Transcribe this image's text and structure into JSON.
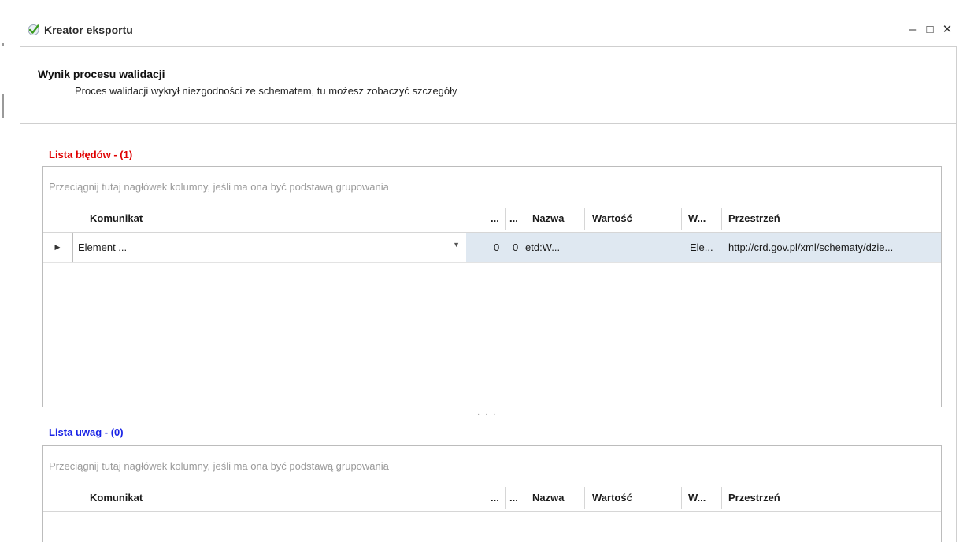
{
  "window": {
    "title": "Kreator eksportu",
    "buttons": {
      "minimize": "‒",
      "maximize": "□",
      "close": "✕"
    }
  },
  "header": {
    "title": "Wynik procesu walidacji",
    "subtitle": "Proces walidacji wykrył niezgodności ze schematem, tu możesz zobaczyć szczegóły"
  },
  "errors": {
    "label": "Lista błędów - (1)",
    "label_color": "#e00000",
    "group_panel": "Przeciągnij tutaj nagłówek kolumny, jeśli ma ona być podstawą grupowania",
    "columns": [
      "Komunikat",
      "...",
      "...",
      "Nazwa",
      "Wartość",
      "W...",
      "Przestrzeń"
    ],
    "rows": [
      {
        "komunikat": "Element ...",
        "c1": "0",
        "c2": "0",
        "nazwa": "etd:W...",
        "wartosc": "",
        "w": "Ele...",
        "przestrzen": "http://crd.gov.pl/xml/schematy/dzie..."
      }
    ]
  },
  "notes": {
    "label": "Lista uwag - (0)",
    "label_color": "#1a24e6",
    "group_panel": "Przeciągnij tutaj nagłówek kolumny, jeśli ma ona być podstawą grupowania",
    "columns": [
      "Komunikat",
      "...",
      "...",
      "Nazwa",
      "Wartość",
      "W...",
      "Przestrzeń"
    ]
  },
  "splitter": "· · ·",
  "selection_color": "#dfe8f1",
  "icons": {
    "title": "check-icon",
    "row_indicator": "row-indicator-icon",
    "dropdown": "chevron-down-icon"
  }
}
